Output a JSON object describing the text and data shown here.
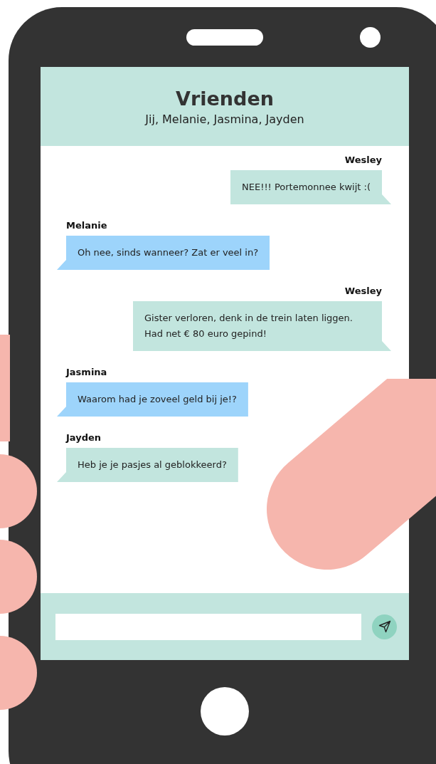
{
  "chat": {
    "title": "Vrienden",
    "members": "Jij, Melanie, Jasmina, Jayden"
  },
  "messages": [
    {
      "sender": "Wesley",
      "text": "NEE!!! Portemonnee kwijt :(",
      "kind": "sent",
      "color": "#c2e5de"
    },
    {
      "sender": "Melanie",
      "text": "Oh nee, sinds wanneer? Zat er veel in?",
      "kind": "received",
      "color": "#9dd4fb"
    },
    {
      "sender": "Wesley",
      "text": "Gister verloren, denk in de trein laten liggen. Had net € 80 euro gepind!",
      "kind": "sent",
      "color": "#c2e5de"
    },
    {
      "sender": "Jasmina",
      "text": "Waarom had je zoveel geld bij je!?",
      "kind": "received",
      "color": "#9dd4fb"
    },
    {
      "sender": "Jayden",
      "text": "Heb je je pasjes al geblokkeerd?",
      "kind": "received",
      "color": "#c2e5de"
    }
  ]
}
